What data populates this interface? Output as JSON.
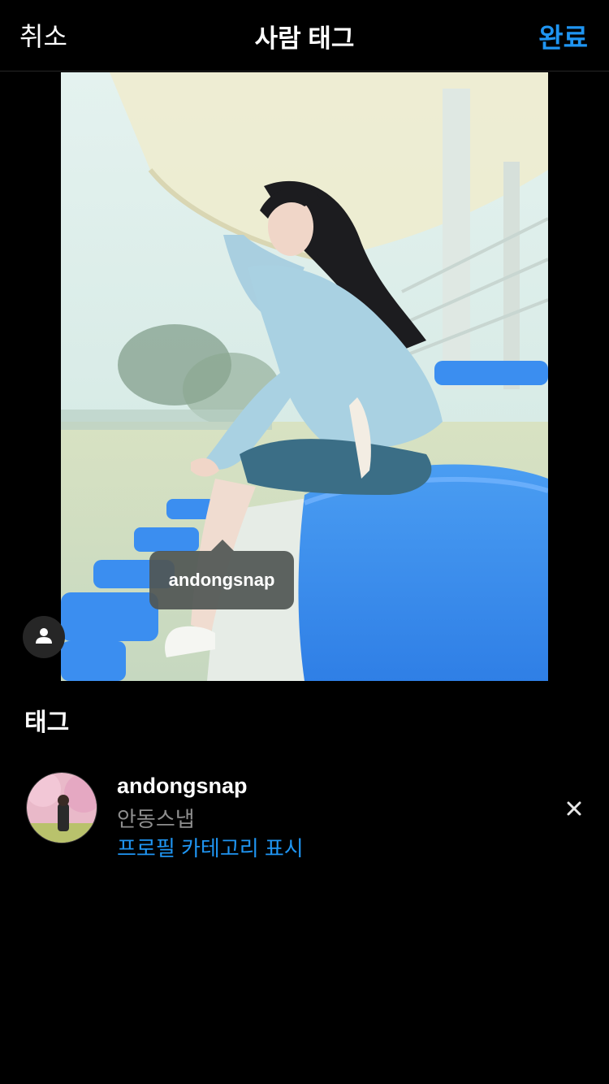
{
  "nav": {
    "cancel_label": "취소",
    "title": "사람 태그",
    "done_label": "완료"
  },
  "photo": {
    "tag_label": "andongsnap"
  },
  "tags_section": {
    "title": "태그",
    "items": [
      {
        "username": "andongsnap",
        "full_name": "안동스냅",
        "category_link": "프로필 카테고리 표시"
      }
    ]
  },
  "colors": {
    "accent": "#1f95f2",
    "background": "#000000",
    "secondary_text": "#8e8e8e"
  },
  "icons": [
    "person-icon",
    "close-icon"
  ]
}
